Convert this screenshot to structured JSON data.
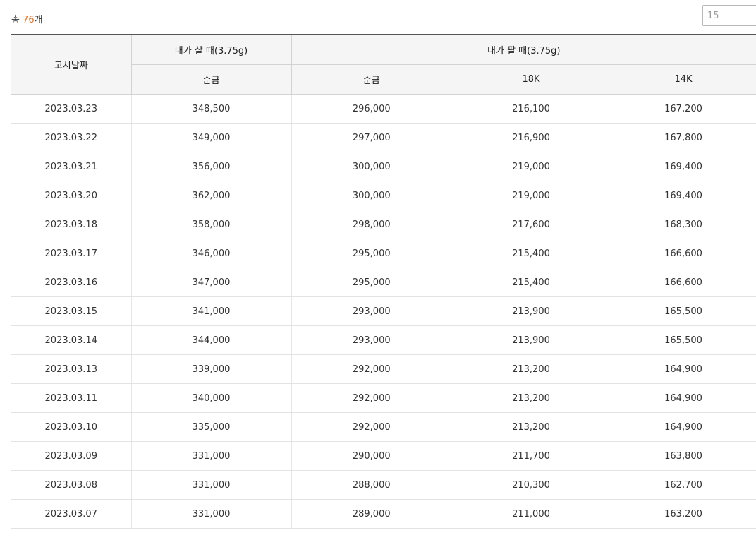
{
  "summary": {
    "prefix": "총 ",
    "count": "76",
    "suffix": "개"
  },
  "per_page": {
    "value": "15"
  },
  "header": {
    "date": "고시날짜",
    "buy_group": "내가 살 때(3.75g)",
    "sell_group": "내가 팔 때(3.75g)",
    "buy_pure": "순금",
    "sell_pure": "순금",
    "sell_18k": "18K",
    "sell_14k": "14K"
  },
  "rows": [
    {
      "date": "2023.03.23",
      "buy_pure": "348,500",
      "sell_pure": "296,000",
      "sell_18k": "216,100",
      "sell_14k": "167,200"
    },
    {
      "date": "2023.03.22",
      "buy_pure": "349,000",
      "sell_pure": "297,000",
      "sell_18k": "216,900",
      "sell_14k": "167,800"
    },
    {
      "date": "2023.03.21",
      "buy_pure": "356,000",
      "sell_pure": "300,000",
      "sell_18k": "219,000",
      "sell_14k": "169,400"
    },
    {
      "date": "2023.03.20",
      "buy_pure": "362,000",
      "sell_pure": "300,000",
      "sell_18k": "219,000",
      "sell_14k": "169,400"
    },
    {
      "date": "2023.03.18",
      "buy_pure": "358,000",
      "sell_pure": "298,000",
      "sell_18k": "217,600",
      "sell_14k": "168,300"
    },
    {
      "date": "2023.03.17",
      "buy_pure": "346,000",
      "sell_pure": "295,000",
      "sell_18k": "215,400",
      "sell_14k": "166,600"
    },
    {
      "date": "2023.03.16",
      "buy_pure": "347,000",
      "sell_pure": "295,000",
      "sell_18k": "215,400",
      "sell_14k": "166,600"
    },
    {
      "date": "2023.03.15",
      "buy_pure": "341,000",
      "sell_pure": "293,000",
      "sell_18k": "213,900",
      "sell_14k": "165,500"
    },
    {
      "date": "2023.03.14",
      "buy_pure": "344,000",
      "sell_pure": "293,000",
      "sell_18k": "213,900",
      "sell_14k": "165,500"
    },
    {
      "date": "2023.03.13",
      "buy_pure": "339,000",
      "sell_pure": "292,000",
      "sell_18k": "213,200",
      "sell_14k": "164,900"
    },
    {
      "date": "2023.03.11",
      "buy_pure": "340,000",
      "sell_pure": "292,000",
      "sell_18k": "213,200",
      "sell_14k": "164,900"
    },
    {
      "date": "2023.03.10",
      "buy_pure": "335,000",
      "sell_pure": "292,000",
      "sell_18k": "213,200",
      "sell_14k": "164,900"
    },
    {
      "date": "2023.03.09",
      "buy_pure": "331,000",
      "sell_pure": "290,000",
      "sell_18k": "211,700",
      "sell_14k": "163,800"
    },
    {
      "date": "2023.03.08",
      "buy_pure": "331,000",
      "sell_pure": "288,000",
      "sell_18k": "210,300",
      "sell_14k": "162,700"
    },
    {
      "date": "2023.03.07",
      "buy_pure": "331,000",
      "sell_pure": "289,000",
      "sell_18k": "211,000",
      "sell_14k": "163,200"
    }
  ]
}
